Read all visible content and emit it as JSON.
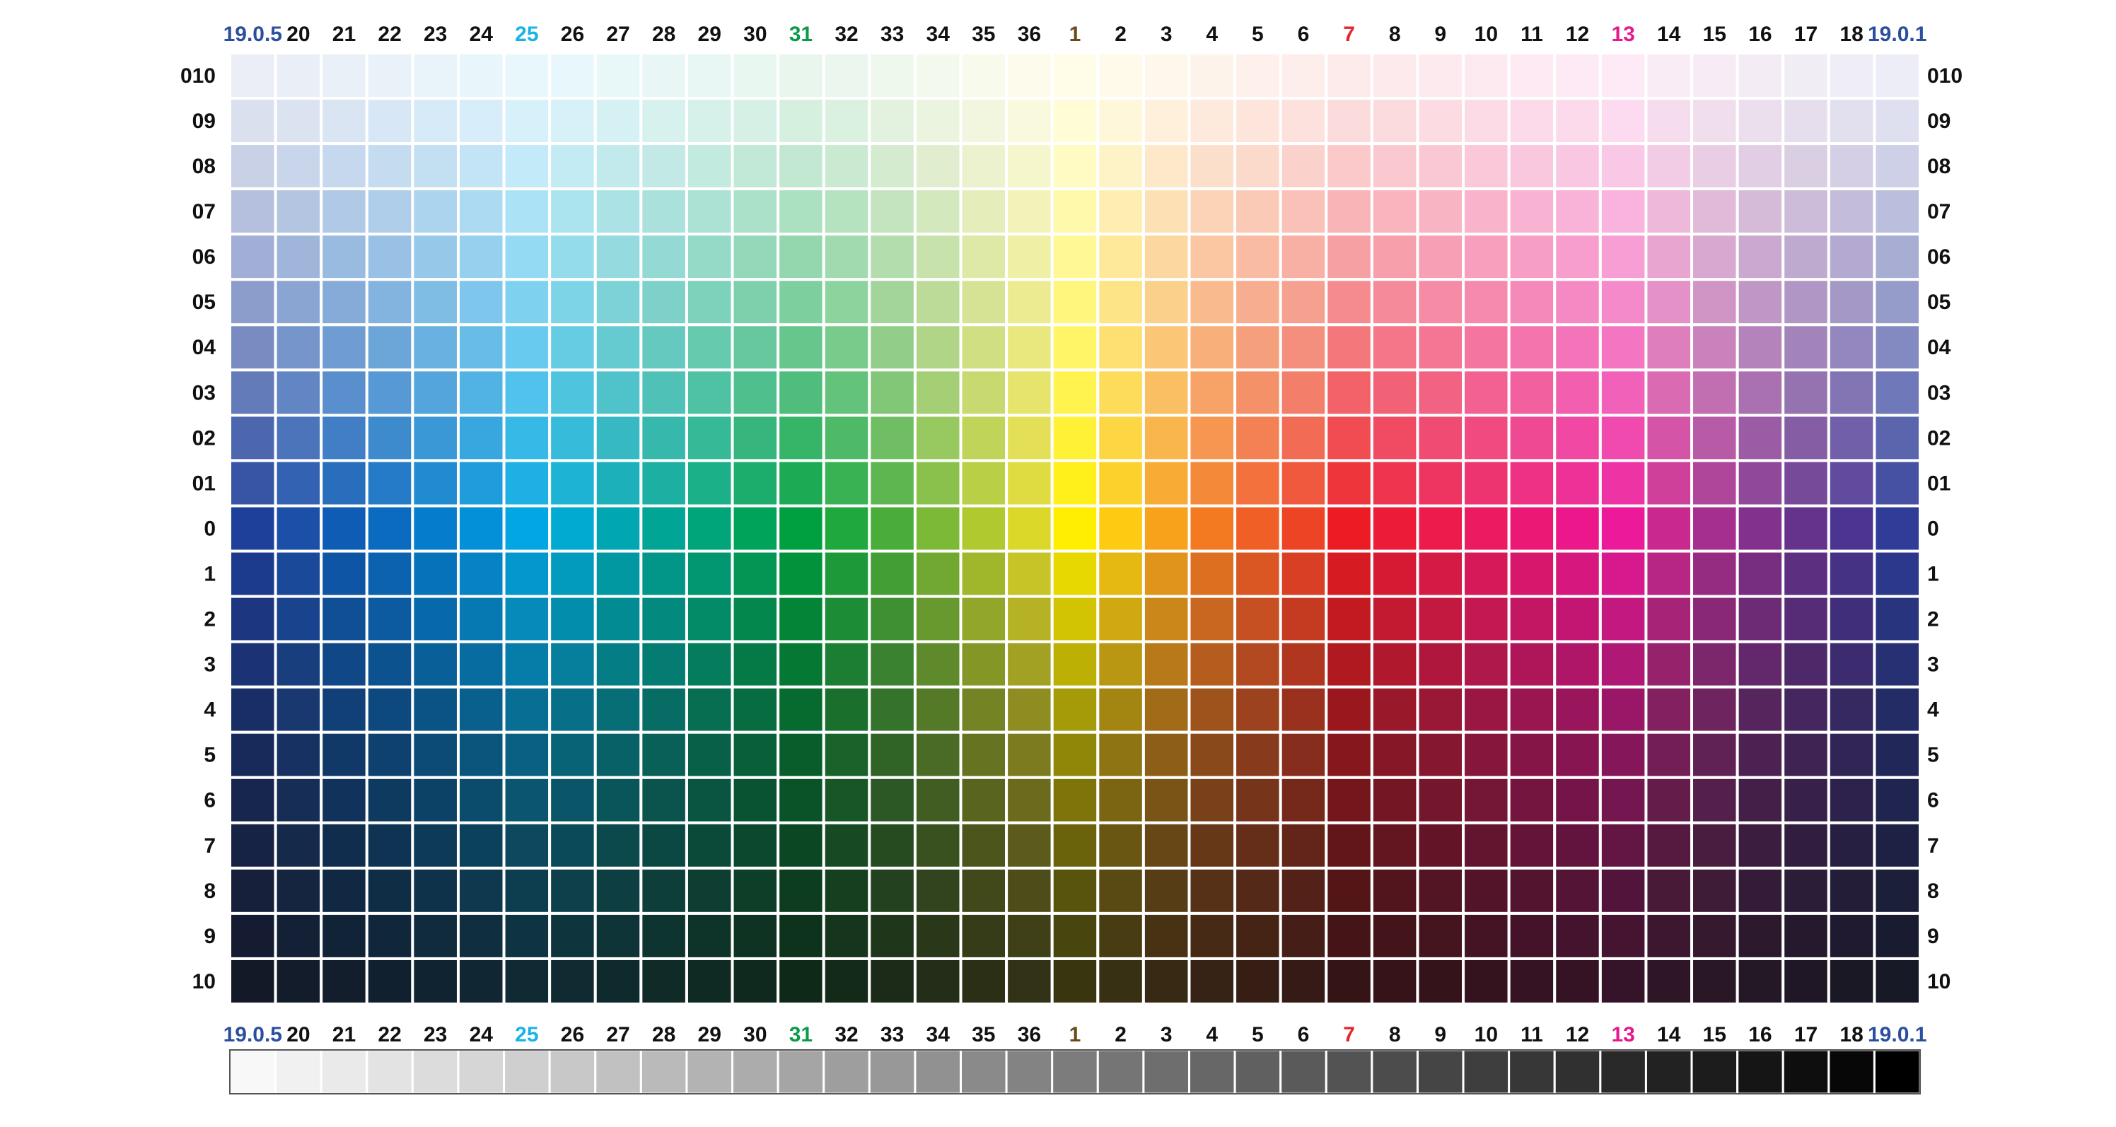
{
  "colors": {
    "label_default": "#111111",
    "label_blue": "#2a4f9e",
    "label_cyan": "#19b3e6",
    "label_green": "#0a9b4a",
    "label_brown": "#6b4a1a",
    "label_red": "#e8242a",
    "label_magenta": "#e6198c",
    "grid_line": "#ffffff"
  },
  "columns": [
    {
      "label": "19.0.5",
      "color": "label_blue"
    },
    {
      "label": "20",
      "color": "label_default"
    },
    {
      "label": "21",
      "color": "label_default"
    },
    {
      "label": "22",
      "color": "label_default"
    },
    {
      "label": "23",
      "color": "label_default"
    },
    {
      "label": "24",
      "color": "label_default"
    },
    {
      "label": "25",
      "color": "label_cyan"
    },
    {
      "label": "26",
      "color": "label_default"
    },
    {
      "label": "27",
      "color": "label_default"
    },
    {
      "label": "28",
      "color": "label_default"
    },
    {
      "label": "29",
      "color": "label_default"
    },
    {
      "label": "30",
      "color": "label_default"
    },
    {
      "label": "31",
      "color": "label_green"
    },
    {
      "label": "32",
      "color": "label_default"
    },
    {
      "label": "33",
      "color": "label_default"
    },
    {
      "label": "34",
      "color": "label_default"
    },
    {
      "label": "35",
      "color": "label_default"
    },
    {
      "label": "36",
      "color": "label_default"
    },
    {
      "label": "1",
      "color": "label_brown"
    },
    {
      "label": "2",
      "color": "label_default"
    },
    {
      "label": "3",
      "color": "label_default"
    },
    {
      "label": "4",
      "color": "label_default"
    },
    {
      "label": "5",
      "color": "label_default"
    },
    {
      "label": "6",
      "color": "label_default"
    },
    {
      "label": "7",
      "color": "label_red"
    },
    {
      "label": "8",
      "color": "label_default"
    },
    {
      "label": "9",
      "color": "label_default"
    },
    {
      "label": "10",
      "color": "label_default"
    },
    {
      "label": "11",
      "color": "label_default"
    },
    {
      "label": "12",
      "color": "label_default"
    },
    {
      "label": "13",
      "color": "label_magenta"
    },
    {
      "label": "14",
      "color": "label_default"
    },
    {
      "label": "15",
      "color": "label_default"
    },
    {
      "label": "16",
      "color": "label_default"
    },
    {
      "label": "17",
      "color": "label_default"
    },
    {
      "label": "18",
      "color": "label_default"
    },
    {
      "label": "19.0.1",
      "color": "label_blue"
    }
  ],
  "rows": [
    "010",
    "09",
    "08",
    "07",
    "06",
    "05",
    "04",
    "03",
    "02",
    "01",
    "0",
    "1",
    "2",
    "3",
    "4",
    "5",
    "6",
    "7",
    "8",
    "9",
    "10"
  ],
  "hue_anchor_colors": [
    "#1e3f9a",
    "#1b4fa8",
    "#0f5cb5",
    "#0a6bc0",
    "#057dcc",
    "#0390d8",
    "#02a6e2",
    "#00aad0",
    "#00a7b2",
    "#00a596",
    "#00a67a",
    "#00a35a",
    "#00a040",
    "#1fa83e",
    "#4aad3a",
    "#7cb936",
    "#b0c92e",
    "#dbd82a",
    "#ffee00",
    "#fccb12",
    "#f8a21c",
    "#f47a22",
    "#f05f25",
    "#ee4426",
    "#ed1c24",
    "#ec1b38",
    "#ec1b4c",
    "#ec1a60",
    "#ec1876",
    "#ec178a",
    "#ec1a9a",
    "#c9288f",
    "#a52f8e",
    "#82318d",
    "#65328c",
    "#4c3592",
    "#2f3c98"
  ],
  "tint_levels": [
    0.91,
    0.84,
    0.76,
    0.67,
    0.58,
    0.49,
    0.4,
    0.31,
    0.21,
    0.11,
    0.0
  ],
  "shade_levels": [
    0.1,
    0.19,
    0.28,
    0.38,
    0.47,
    0.55,
    0.63,
    0.7,
    0.77,
    0.84
  ],
  "grayscale_steps": 37
}
